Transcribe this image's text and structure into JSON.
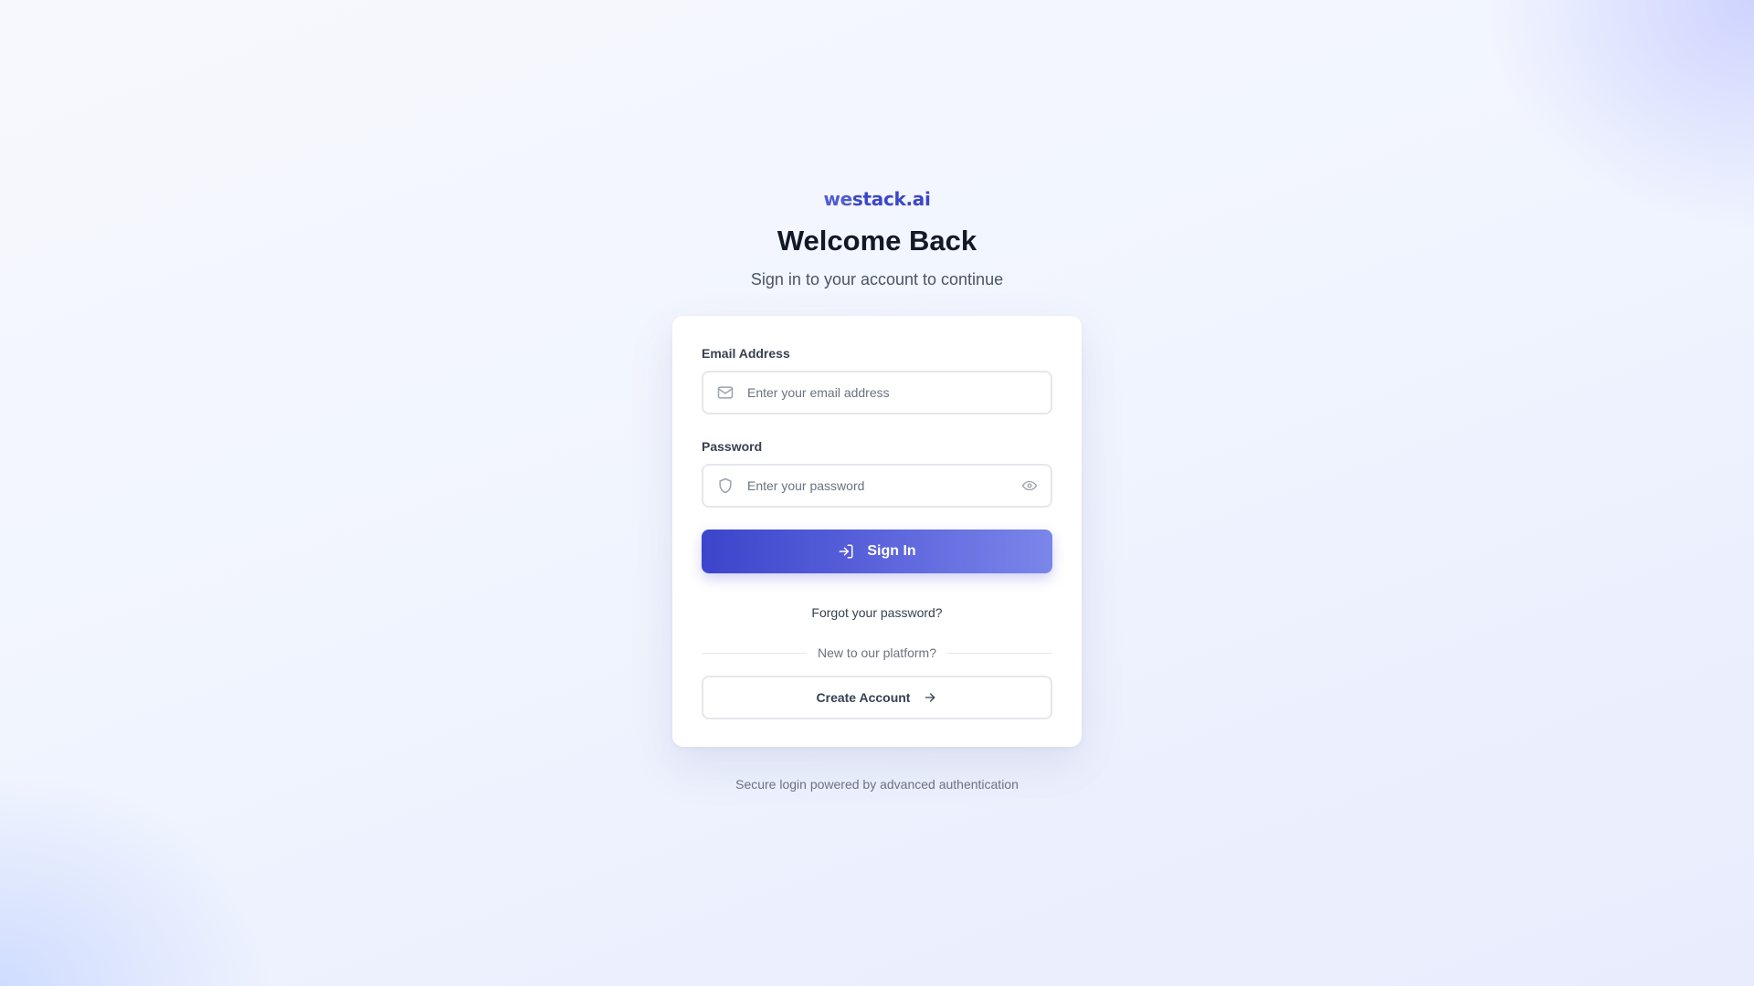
{
  "brand": {
    "logo_prefix": "we",
    "logo_rest": "stack.ai",
    "accent_color": "#3b46c9"
  },
  "header": {
    "title": "Welcome Back",
    "subtitle": "Sign in to your account to continue"
  },
  "form": {
    "email": {
      "label": "Email Address",
      "placeholder": "Enter your email address",
      "value": "",
      "icon": "mail-icon"
    },
    "password": {
      "label": "Password",
      "placeholder": "Enter your password",
      "value": "",
      "icon": "shield-icon",
      "toggle_icon": "eye-icon"
    },
    "sign_in_label": "Sign In",
    "sign_in_icon": "log-in-icon",
    "forgot_label": "Forgot your password?",
    "divider_text": "New to our platform?",
    "create_account_label": "Create Account",
    "create_account_icon": "arrow-right-icon"
  },
  "footer": {
    "text": "Secure login powered by advanced authentication"
  }
}
